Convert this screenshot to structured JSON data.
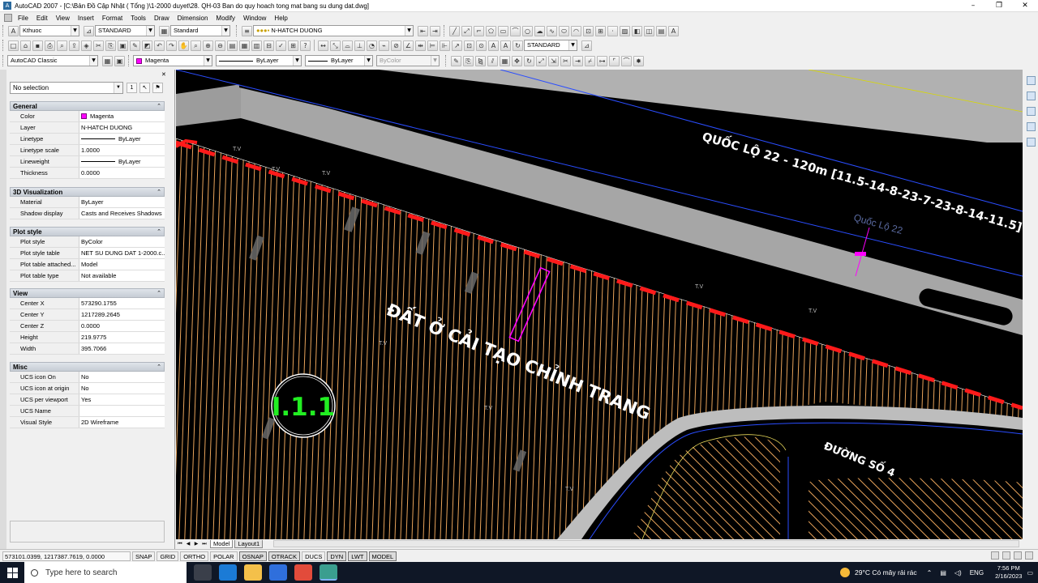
{
  "window": {
    "title": "AutoCAD 2007 - [C:\\Bản Đồ Cập Nhật ( Tổng )\\1-2000 duyet\\28. QH-03 Ban do quy hoach tong mat bang su dung dat.dwg]",
    "app_icon": "A"
  },
  "menu": [
    "File",
    "Edit",
    "View",
    "Insert",
    "Format",
    "Tools",
    "Draw",
    "Dimension",
    "Modify",
    "Window",
    "Help"
  ],
  "toolbar1": {
    "dimstyle": "Kthuoc",
    "textstyle": "STANDARD",
    "tablestyle": "Standard",
    "layer": "N-HATCH DUONG"
  },
  "toolbar2": {
    "style": "STANDARD"
  },
  "toolbar3": {
    "workspace": "AutoCAD Classic",
    "color": "Magenta",
    "linetype": "ByLayer",
    "lineweight": "ByLayer",
    "plotstyle": "ByColor"
  },
  "props": {
    "selection": "No selection",
    "sections": [
      {
        "title": "General",
        "rows": [
          {
            "name": "Color",
            "value": "Magenta",
            "kind": "color"
          },
          {
            "name": "Layer",
            "value": "N-HATCH DUONG"
          },
          {
            "name": "Linetype",
            "value": "ByLayer",
            "kind": "line"
          },
          {
            "name": "Linetype scale",
            "value": "1.0000"
          },
          {
            "name": "Lineweight",
            "value": "ByLayer",
            "kind": "line"
          },
          {
            "name": "Thickness",
            "value": "0.0000"
          }
        ]
      },
      {
        "title": "3D Visualization",
        "rows": [
          {
            "name": "Material",
            "value": "ByLayer"
          },
          {
            "name": "Shadow display",
            "value": "Casts and Receives Shadows"
          }
        ]
      },
      {
        "title": "Plot style",
        "rows": [
          {
            "name": "Plot style",
            "value": "ByColor"
          },
          {
            "name": "Plot style table",
            "value": "NET SU DUNG DAT 1-2000.c..."
          },
          {
            "name": "Plot table attached...",
            "value": "Model"
          },
          {
            "name": "Plot table type",
            "value": "Not available"
          }
        ]
      },
      {
        "title": "View",
        "rows": [
          {
            "name": "Center X",
            "value": "573290.1755"
          },
          {
            "name": "Center Y",
            "value": "1217289.2645"
          },
          {
            "name": "Center Z",
            "value": "0.0000"
          },
          {
            "name": "Height",
            "value": "219.9775"
          },
          {
            "name": "Width",
            "value": "395.7066"
          }
        ]
      },
      {
        "title": "Misc",
        "rows": [
          {
            "name": "UCS icon On",
            "value": "No"
          },
          {
            "name": "UCS icon at origin",
            "value": "No"
          },
          {
            "name": "UCS per viewport",
            "value": "Yes"
          },
          {
            "name": "UCS Name",
            "value": ""
          },
          {
            "name": "Visual Style",
            "value": "2D Wireframe"
          }
        ]
      }
    ]
  },
  "drawing": {
    "road_label": "QUỐC LỘ 22 - 120m [11.5-14-8-23-7-23-8-14-11.5]",
    "road_name": "Quốc Lộ 22",
    "zone_label": "ĐẤT Ở CẢI TẠO CHỈNH TRANG",
    "street_label": "ĐƯỜNG SỐ 4",
    "plot_code": "I.1.1",
    "small_labels": [
      "T.V",
      "T.V",
      "T.V",
      "T.V",
      "T.V",
      "T.V",
      "T.V",
      "T.V"
    ],
    "colors": {
      "hatch": "#e8a35a",
      "road": "#a8a8a8",
      "dash": "#ff1a1a",
      "magenta": "#ff00ff",
      "blue": "#2a4dff"
    }
  },
  "layout_tabs": [
    "Model",
    "Layout1"
  ],
  "status": {
    "coords": "573101.0399, 1217387.7619, 0.0000",
    "buttons": [
      "SNAP",
      "GRID",
      "ORTHO",
      "POLAR",
      "OSNAP",
      "OTRACK",
      "DUCS",
      "DYN",
      "LWT",
      "MODEL"
    ],
    "on_buttons": [
      "OSNAP",
      "OTRACK",
      "DYN",
      "LWT",
      "MODEL"
    ]
  },
  "taskbar": {
    "search_placeholder": "Type here to search",
    "weather": "29°C  Có mây rải rác",
    "lang": "ENG",
    "time": "7:56 PM",
    "date": "2/16/2023"
  }
}
